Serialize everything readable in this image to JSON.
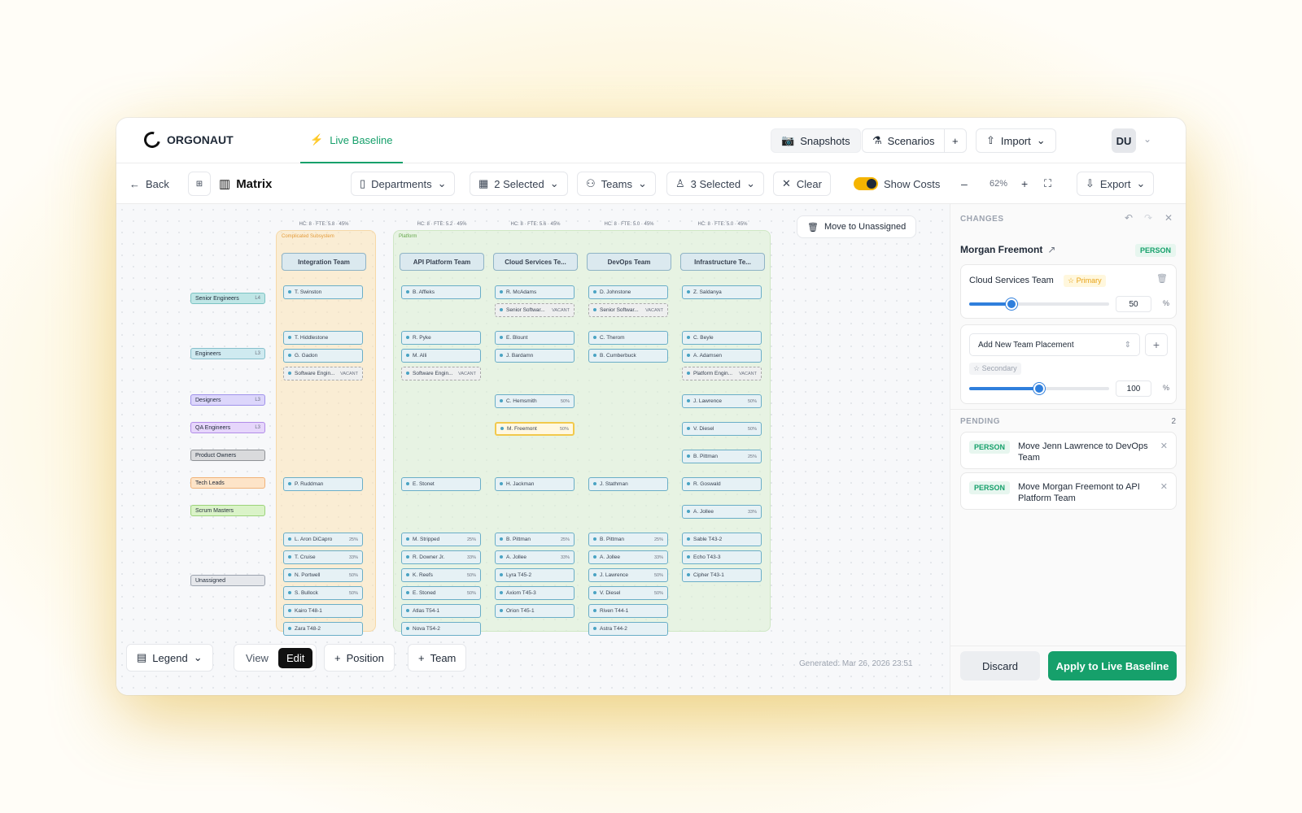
{
  "app": {
    "name": "ORGONAUT",
    "live_tab": "Live Baseline"
  },
  "topbar": {
    "snapshots": "Snapshots",
    "scenarios": "Scenarios",
    "plus": "+",
    "import": "Import",
    "avatar": "DU"
  },
  "toolbar": {
    "back": "Back",
    "view_name": "Matrix",
    "departments": "Departments",
    "dept_selected": "2 Selected",
    "teams": "Teams",
    "teams_selected": "3 Selected",
    "clear": "Clear",
    "show_costs": "Show Costs",
    "minus": "–",
    "zoom": "62%",
    "plus": "+",
    "export": "Export"
  },
  "canvas": {
    "move_btn": "Move to  Unassigned",
    "zones": [
      {
        "label": "Complicated Subsystem"
      },
      {
        "label": "Platform"
      }
    ],
    "meta": [
      "HC: 8 · FTE: 5.8 · 45%",
      "HC: 8 · FTE: 5.2 · 45%",
      "HC: 8 · FTE: 5.6 · 45%",
      "HC: 8 · FTE: 5.0 · 45%",
      "HC: 8 · FTE: 5.0 · 45%"
    ],
    "teams": [
      "Integration Team",
      "API Platform Team",
      "Cloud Services Te...",
      "DevOps Team",
      "Infrastructure Te..."
    ],
    "roles": [
      {
        "label": "Senior Engineers",
        "level": "L4",
        "color": "#bfe6e6",
        "border": "#7cc3c3"
      },
      {
        "label": "Engineers",
        "level": "L3",
        "color": "#cfeaf0",
        "border": "#86c0cc"
      },
      {
        "label": "Designers",
        "level": "L3",
        "color": "#dcd6fb",
        "border": "#9f92ea"
      },
      {
        "label": "QA Engineers",
        "level": "L3",
        "color": "#e6d6fb",
        "border": "#b18be8"
      },
      {
        "label": "Product Owners",
        "level": "",
        "color": "#d9dadc",
        "border": "#8f9296"
      },
      {
        "label": "Tech Leads",
        "level": "",
        "color": "#fde4c8",
        "border": "#f0b37a"
      },
      {
        "label": "Scrum Masters",
        "level": "",
        "color": "#daf3c8",
        "border": "#9bd37a"
      },
      {
        "label": "Unassigned",
        "level": "",
        "color": "#e5e7eb",
        "border": "#9ca3af"
      }
    ],
    "cards": [
      {
        "c": 0,
        "r": 0,
        "t": "T. Swinston",
        "p": ""
      },
      {
        "c": 1,
        "r": 0,
        "t": "B. Affleks",
        "p": ""
      },
      {
        "c": 2,
        "r": 0,
        "t": "R. McAdams",
        "p": ""
      },
      {
        "c": 2,
        "r": 1,
        "t": "Senior Softwar...",
        "p": "VACANT",
        "v": true
      },
      {
        "c": 3,
        "r": 0,
        "t": "D. Johnstone",
        "p": ""
      },
      {
        "c": 3,
        "r": 1,
        "t": "Senior Softwar...",
        "p": "VACANT",
        "v": true
      },
      {
        "c": 4,
        "r": 0,
        "t": "Z. Saldanya",
        "p": ""
      },
      {
        "c": 0,
        "r": 2,
        "t": "T. Hiddlestone",
        "p": ""
      },
      {
        "c": 0,
        "r": 3,
        "t": "G. Gadon",
        "p": ""
      },
      {
        "c": 0,
        "r": 4,
        "t": "Software Engin...",
        "p": "VACANT",
        "v": true
      },
      {
        "c": 1,
        "r": 2,
        "t": "R. Pyke",
        "p": ""
      },
      {
        "c": 1,
        "r": 3,
        "t": "M. Alli",
        "p": ""
      },
      {
        "c": 1,
        "r": 4,
        "t": "Software Engin...",
        "p": "VACANT",
        "v": true
      },
      {
        "c": 2,
        "r": 2,
        "t": "E. Blount",
        "p": ""
      },
      {
        "c": 2,
        "r": 3,
        "t": "J. Bardamn",
        "p": ""
      },
      {
        "c": 3,
        "r": 2,
        "t": "C. Therom",
        "p": ""
      },
      {
        "c": 3,
        "r": 3,
        "t": "B. Cumberbuck",
        "p": ""
      },
      {
        "c": 4,
        "r": 2,
        "t": "C. Beyle",
        "p": ""
      },
      {
        "c": 4,
        "r": 3,
        "t": "A. Adamsen",
        "p": ""
      },
      {
        "c": 4,
        "r": 4,
        "t": "Platform Engin...",
        "p": "VACANT",
        "v": true
      },
      {
        "c": 2,
        "r": 5,
        "t": "C. Hemsmith",
        "p": "50%"
      },
      {
        "c": 4,
        "r": 5,
        "t": "J. Lawrence",
        "p": "50%"
      },
      {
        "c": 2,
        "r": 6,
        "t": "M. Freemont",
        "p": "50%",
        "s": true
      },
      {
        "c": 4,
        "r": 6,
        "t": "V. Diesel",
        "p": "50%"
      },
      {
        "c": 4,
        "r": 7,
        "t": "B. Pittman",
        "p": "25%"
      },
      {
        "c": 0,
        "r": 8,
        "t": "P. Ruddman",
        "p": ""
      },
      {
        "c": 1,
        "r": 8,
        "t": "E. Stonet",
        "p": ""
      },
      {
        "c": 2,
        "r": 8,
        "t": "H. Jackman",
        "p": ""
      },
      {
        "c": 3,
        "r": 8,
        "t": "J. Stathman",
        "p": ""
      },
      {
        "c": 4,
        "r": 8,
        "t": "R. Goswald",
        "p": ""
      },
      {
        "c": 4,
        "r": 9,
        "t": "A. Jollee",
        "p": "33%"
      },
      {
        "c": 0,
        "r": 10,
        "t": "L. Aron DiCapro",
        "p": "25%"
      },
      {
        "c": 0,
        "r": 11,
        "t": "T. Cruise",
        "p": "33%"
      },
      {
        "c": 0,
        "r": 12,
        "t": "N. Portwell",
        "p": "50%"
      },
      {
        "c": 0,
        "r": 13,
        "t": "S. Bullock",
        "p": "50%"
      },
      {
        "c": 0,
        "r": 14,
        "t": "Kairo T48-1",
        "p": ""
      },
      {
        "c": 0,
        "r": 15,
        "t": "Zara T48-2",
        "p": ""
      },
      {
        "c": 1,
        "r": 10,
        "t": "M. Stripped",
        "p": "25%"
      },
      {
        "c": 1,
        "r": 11,
        "t": "R. Downer Jr.",
        "p": "33%"
      },
      {
        "c": 1,
        "r": 12,
        "t": "K. Reefs",
        "p": "50%"
      },
      {
        "c": 1,
        "r": 13,
        "t": "E. Stoned",
        "p": "50%"
      },
      {
        "c": 1,
        "r": 14,
        "t": "Atlas T54-1",
        "p": ""
      },
      {
        "c": 1,
        "r": 15,
        "t": "Nova T54-2",
        "p": ""
      },
      {
        "c": 2,
        "r": 10,
        "t": "B. Pittman",
        "p": "25%"
      },
      {
        "c": 2,
        "r": 11,
        "t": "A. Jollee",
        "p": "33%"
      },
      {
        "c": 2,
        "r": 12,
        "t": "Lyra T45-2",
        "p": ""
      },
      {
        "c": 2,
        "r": 13,
        "t": "Axiom T45-3",
        "p": ""
      },
      {
        "c": 2,
        "r": 14,
        "t": "Orion T45-1",
        "p": ""
      },
      {
        "c": 3,
        "r": 10,
        "t": "B. Pittman",
        "p": "25%"
      },
      {
        "c": 3,
        "r": 11,
        "t": "A. Jollee",
        "p": "33%"
      },
      {
        "c": 3,
        "r": 12,
        "t": "J. Lawrence",
        "p": "50%"
      },
      {
        "c": 3,
        "r": 13,
        "t": "V. Diesel",
        "p": "50%"
      },
      {
        "c": 3,
        "r": 14,
        "t": "Riven T44-1",
        "p": ""
      },
      {
        "c": 3,
        "r": 15,
        "t": "Astra T44-2",
        "p": ""
      },
      {
        "c": 4,
        "r": 10,
        "t": "Sable T43-2",
        "p": ""
      },
      {
        "c": 4,
        "r": 11,
        "t": "Echo T43-3",
        "p": ""
      },
      {
        "c": 4,
        "r": 12,
        "t": "Cipher T43-1",
        "p": ""
      }
    ],
    "legend": "Legend",
    "view": "View",
    "edit": "Edit",
    "position": "Position",
    "team": "Team",
    "generated": "Generated: Mar 26, 2026 23:51"
  },
  "panel": {
    "changes": "CHANGES",
    "person_name": "Morgan Freemont",
    "person_badge": "PERSON",
    "placement1": {
      "team": "Cloud Services Team",
      "tag": "Primary",
      "value": "50",
      "unit": "%",
      "fraction": 0.3
    },
    "add_placement": "Add New Team Placement",
    "placement2": {
      "tag": "Secondary",
      "value": "100",
      "unit": "%",
      "fraction": 0.5
    },
    "pending": "PENDING",
    "pending_count": "2",
    "pending_items": [
      {
        "badge": "PERSON",
        "text": "Move Jenn Lawrence to DevOps Team"
      },
      {
        "badge": "PERSON",
        "text": "Move Morgan Freemont to API Platform Team"
      }
    ],
    "discard": "Discard",
    "apply": "Apply to Live Baseline"
  }
}
